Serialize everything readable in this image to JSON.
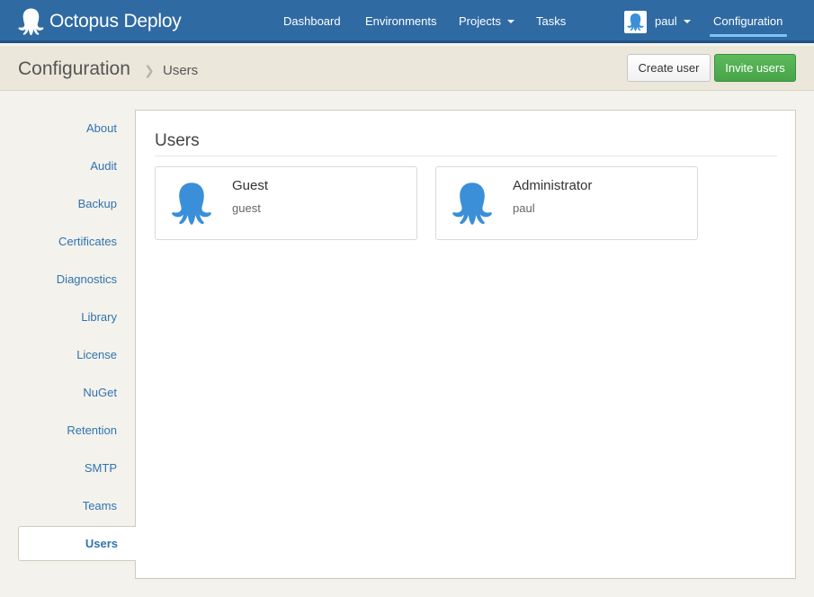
{
  "app": {
    "name": "Octopus Deploy"
  },
  "nav": {
    "items": [
      {
        "label": "Dashboard"
      },
      {
        "label": "Environments"
      },
      {
        "label": "Projects"
      },
      {
        "label": "Tasks"
      }
    ],
    "user": "paul",
    "configuration": "Configuration"
  },
  "header": {
    "title": "Configuration",
    "breadcrumb": "Users",
    "create_user_label": "Create user",
    "invite_users_label": "Invite users"
  },
  "sidebar": {
    "items": [
      {
        "label": "About"
      },
      {
        "label": "Audit"
      },
      {
        "label": "Backup"
      },
      {
        "label": "Certificates"
      },
      {
        "label": "Diagnostics"
      },
      {
        "label": "Library"
      },
      {
        "label": "License"
      },
      {
        "label": "NuGet"
      },
      {
        "label": "Retention"
      },
      {
        "label": "SMTP"
      },
      {
        "label": "Teams"
      }
    ],
    "active": "Users"
  },
  "main": {
    "title": "Users",
    "users": [
      {
        "display_name": "Guest",
        "username": "guest",
        "avatar_icon": "octopus-icon"
      },
      {
        "display_name": "Administrator",
        "username": "paul",
        "avatar_icon": "octopus-icon"
      }
    ]
  },
  "colors": {
    "topbar": "#2f6aa3",
    "header_bar": "#ebe7da",
    "link": "#2f73b0",
    "accent_octopus": "#3a8fd8",
    "success_button": "#47a447"
  }
}
